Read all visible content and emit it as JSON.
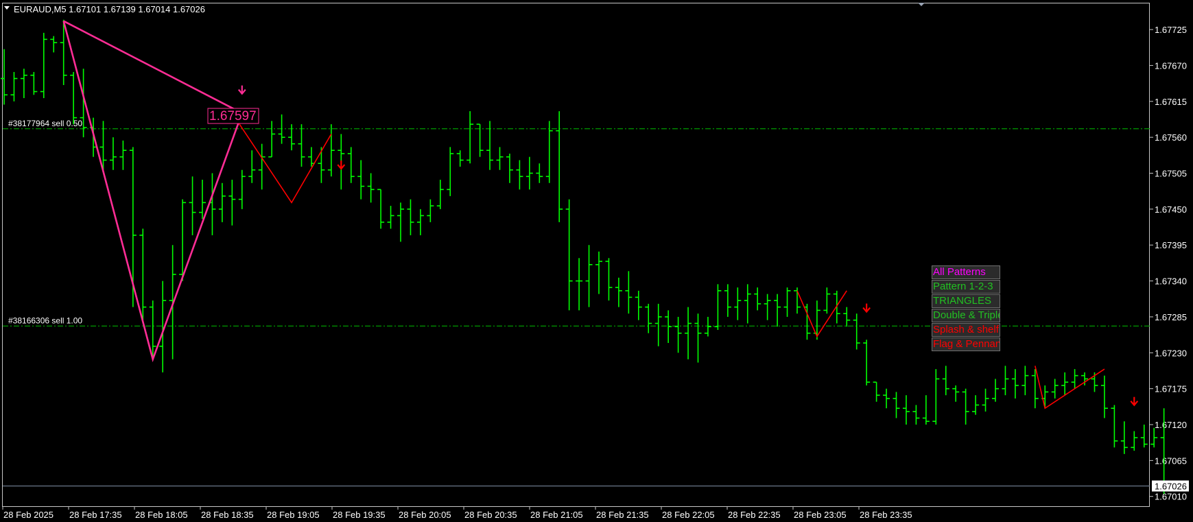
{
  "header": {
    "symbol_info": "EURAUD,M5  1.67101 1.67139 1.67014 1.67026"
  },
  "colors": {
    "background": "#000000",
    "bars": "#00ff00",
    "grid_line": "#00c000",
    "pattern_pink": "#ff2d95",
    "pattern_red": "#ff0000",
    "arrow_red": "#ff0000",
    "current_price_line": "#7f8fa6"
  },
  "orders": [
    {
      "label": "#38177964 sell 0.50",
      "price": 1.67573
    },
    {
      "label": "#38166306 sell 1.00",
      "price": 1.67271
    }
  ],
  "current_price": {
    "label": "1.67026",
    "price": 1.67026
  },
  "pattern_label": {
    "text": "1.67597"
  },
  "panel": {
    "items": [
      {
        "label": "All Patterns",
        "color": "#ff00ff"
      },
      {
        "label": "Pattern 1-2-3",
        "color": "#22c022"
      },
      {
        "label": "TRIANGLES",
        "color": "#22c022"
      },
      {
        "label": "Double & Triple",
        "color": "#22c022"
      },
      {
        "label": "Splash & shelf",
        "color": "#ff0000"
      },
      {
        "label": "Flag & Pennant",
        "color": "#ff0000"
      }
    ]
  },
  "chart_data": {
    "type": "ohlc",
    "y_axis_ticks": [
      1.67725,
      1.6767,
      1.67615,
      1.6756,
      1.67505,
      1.6745,
      1.67395,
      1.6734,
      1.67285,
      1.6723,
      1.67175,
      1.6712,
      1.67065,
      1.6701
    ],
    "x_axis_labels": [
      "28 Feb 2025",
      "28 Feb 17:35",
      "28 Feb 18:05",
      "28 Feb 18:35",
      "28 Feb 19:05",
      "28 Feb 19:35",
      "28 Feb 20:05",
      "28 Feb 20:35",
      "28 Feb 21:05",
      "28 Feb 21:35",
      "28 Feb 22:05",
      "28 Feb 22:35",
      "28 Feb 23:05",
      "28 Feb 23:35"
    ],
    "ylim": [
      1.66995,
      1.67765
    ],
    "bars": [
      [
        1.6765,
        1.67695,
        1.6761,
        1.67625
      ],
      [
        1.67625,
        1.6766,
        1.67615,
        1.6765
      ],
      [
        1.6765,
        1.67665,
        1.6762,
        1.67655
      ],
      [
        1.67655,
        1.6766,
        1.67625,
        1.6763
      ],
      [
        1.6763,
        1.6772,
        1.6762,
        1.6771
      ],
      [
        1.6771,
        1.67715,
        1.6769,
        1.67705
      ],
      [
        1.67705,
        1.6774,
        1.6764,
        1.67655
      ],
      [
        1.67655,
        1.6766,
        1.6758,
        1.6759
      ],
      [
        1.6759,
        1.67665,
        1.6756,
        1.67575
      ],
      [
        1.67575,
        1.6759,
        1.6753,
        1.67545
      ],
      [
        1.67545,
        1.67585,
        1.6751,
        1.67525
      ],
      [
        1.67525,
        1.6756,
        1.6751,
        1.6753
      ],
      [
        1.6753,
        1.67555,
        1.6751,
        1.6754
      ],
      [
        1.6754,
        1.67545,
        1.673,
        1.6741
      ],
      [
        1.6741,
        1.6742,
        1.6728,
        1.673
      ],
      [
        1.673,
        1.6731,
        1.6722,
        1.6724
      ],
      [
        1.6724,
        1.6734,
        1.672,
        1.6731
      ],
      [
        1.6731,
        1.67395,
        1.6722,
        1.6735
      ],
      [
        1.6735,
        1.67465,
        1.6734,
        1.6746
      ],
      [
        1.6746,
        1.675,
        1.6741,
        1.67445
      ],
      [
        1.67445,
        1.67495,
        1.67435,
        1.6746
      ],
      [
        1.6746,
        1.67505,
        1.6741,
        1.6745
      ],
      [
        1.6745,
        1.6749,
        1.6743,
        1.6747
      ],
      [
        1.6747,
        1.67495,
        1.67425,
        1.67465
      ],
      [
        1.67465,
        1.6751,
        1.6745,
        1.675
      ],
      [
        1.675,
        1.6754,
        1.6749,
        1.6751
      ],
      [
        1.6751,
        1.6755,
        1.6748,
        1.6753
      ],
      [
        1.6753,
        1.67585,
        1.6753,
        1.67565
      ],
      [
        1.67565,
        1.67595,
        1.6755,
        1.6756
      ],
      [
        1.6756,
        1.6758,
        1.6754,
        1.6755
      ],
      [
        1.6755,
        1.6758,
        1.67515,
        1.6753
      ],
      [
        1.6753,
        1.67545,
        1.67515,
        1.6752
      ],
      [
        1.6752,
        1.67545,
        1.6749,
        1.6751
      ],
      [
        1.6751,
        1.6758,
        1.675,
        1.6754
      ],
      [
        1.6754,
        1.67565,
        1.6748,
        1.67535
      ],
      [
        1.67535,
        1.67545,
        1.6749,
        1.675
      ],
      [
        1.675,
        1.67525,
        1.67465,
        1.67485
      ],
      [
        1.67485,
        1.67505,
        1.6746,
        1.6748
      ],
      [
        1.6748,
        1.6748,
        1.6742,
        1.6743
      ],
      [
        1.6743,
        1.67455,
        1.6742,
        1.6744
      ],
      [
        1.6744,
        1.6746,
        1.674,
        1.6745
      ],
      [
        1.6745,
        1.67465,
        1.6741,
        1.6743
      ],
      [
        1.6743,
        1.6745,
        1.6741,
        1.6744
      ],
      [
        1.6744,
        1.67465,
        1.6743,
        1.67455
      ],
      [
        1.67455,
        1.67495,
        1.6745,
        1.6748
      ],
      [
        1.6748,
        1.67545,
        1.6747,
        1.67535
      ],
      [
        1.67535,
        1.6754,
        1.67515,
        1.67525
      ],
      [
        1.67525,
        1.676,
        1.6752,
        1.6758
      ],
      [
        1.6758,
        1.6758,
        1.6753,
        1.6754
      ],
      [
        1.6754,
        1.67585,
        1.6751,
        1.67525
      ],
      [
        1.67525,
        1.67545,
        1.6751,
        1.6753
      ],
      [
        1.6753,
        1.67535,
        1.6749,
        1.6751
      ],
      [
        1.6751,
        1.67525,
        1.6748,
        1.675
      ],
      [
        1.675,
        1.6753,
        1.6748,
        1.67505
      ],
      [
        1.67505,
        1.6752,
        1.6749,
        1.675
      ],
      [
        1.675,
        1.67585,
        1.6749,
        1.6757
      ],
      [
        1.6757,
        1.676,
        1.6743,
        1.6745
      ],
      [
        1.6745,
        1.67465,
        1.67295,
        1.6734
      ],
      [
        1.6734,
        1.67375,
        1.67295,
        1.6734
      ],
      [
        1.6734,
        1.67395,
        1.673,
        1.67365
      ],
      [
        1.67365,
        1.67385,
        1.6732,
        1.6737
      ],
      [
        1.6737,
        1.67375,
        1.6731,
        1.6733
      ],
      [
        1.6733,
        1.67345,
        1.673,
        1.67325
      ],
      [
        1.67325,
        1.67355,
        1.6729,
        1.67315
      ],
      [
        1.67315,
        1.67325,
        1.6728,
        1.673
      ],
      [
        1.673,
        1.67305,
        1.6726,
        1.67275
      ],
      [
        1.67275,
        1.67305,
        1.6724,
        1.67285
      ],
      [
        1.67285,
        1.67295,
        1.67245,
        1.6727
      ],
      [
        1.6727,
        1.67285,
        1.6723,
        1.6726
      ],
      [
        1.6726,
        1.673,
        1.6722,
        1.67275
      ],
      [
        1.67275,
        1.6729,
        1.67215,
        1.6726
      ],
      [
        1.6726,
        1.67285,
        1.67255,
        1.6727
      ],
      [
        1.6727,
        1.67335,
        1.67265,
        1.67325
      ],
      [
        1.67325,
        1.67335,
        1.67285,
        1.673
      ],
      [
        1.673,
        1.6733,
        1.6728,
        1.6731
      ],
      [
        1.6731,
        1.67335,
        1.67275,
        1.6732
      ],
      [
        1.6732,
        1.6733,
        1.67295,
        1.67305
      ],
      [
        1.67305,
        1.6732,
        1.6728,
        1.6731
      ],
      [
        1.6731,
        1.6732,
        1.6727,
        1.673
      ],
      [
        1.673,
        1.6733,
        1.67285,
        1.67325
      ],
      [
        1.67325,
        1.6733,
        1.6729,
        1.673
      ],
      [
        1.673,
        1.67305,
        1.6725,
        1.6726
      ],
      [
        1.6726,
        1.6731,
        1.6725,
        1.67295
      ],
      [
        1.67295,
        1.6733,
        1.6729,
        1.6732
      ],
      [
        1.6732,
        1.67325,
        1.67275,
        1.6729
      ],
      [
        1.6729,
        1.673,
        1.6727,
        1.6728
      ],
      [
        1.6728,
        1.6729,
        1.67235,
        1.67245
      ],
      [
        1.67245,
        1.6725,
        1.6718,
        1.67185
      ],
      [
        1.67185,
        1.67185,
        1.67155,
        1.67165
      ],
      [
        1.67165,
        1.67175,
        1.67145,
        1.6716
      ],
      [
        1.6716,
        1.6717,
        1.6713,
        1.67145
      ],
      [
        1.67145,
        1.67165,
        1.6712,
        1.6714
      ],
      [
        1.6714,
        1.6715,
        1.6712,
        1.6713
      ],
      [
        1.6713,
        1.67165,
        1.6712,
        1.67125
      ],
      [
        1.67125,
        1.67205,
        1.6712,
        1.6719
      ],
      [
        1.6719,
        1.6721,
        1.67165,
        1.67175
      ],
      [
        1.67175,
        1.6718,
        1.67155,
        1.6717
      ],
      [
        1.6717,
        1.67175,
        1.6712,
        1.6714
      ],
      [
        1.6714,
        1.67165,
        1.67135,
        1.6715
      ],
      [
        1.6715,
        1.67175,
        1.6714,
        1.6716
      ],
      [
        1.6716,
        1.6719,
        1.67155,
        1.67175
      ],
      [
        1.67175,
        1.6721,
        1.67165,
        1.6719
      ],
      [
        1.6719,
        1.67205,
        1.6716,
        1.6718
      ],
      [
        1.6718,
        1.6721,
        1.67165,
        1.67195
      ],
      [
        1.67195,
        1.67205,
        1.67145,
        1.6716
      ],
      [
        1.6716,
        1.6718,
        1.67145,
        1.6717
      ],
      [
        1.6717,
        1.6719,
        1.6716,
        1.6718
      ],
      [
        1.6718,
        1.672,
        1.67165,
        1.67185
      ],
      [
        1.67185,
        1.67205,
        1.67175,
        1.67195
      ],
      [
        1.67195,
        1.672,
        1.6718,
        1.6719
      ],
      [
        1.6719,
        1.672,
        1.6717,
        1.6718
      ],
      [
        1.6718,
        1.67195,
        1.6713,
        1.67145
      ],
      [
        1.67145,
        1.6715,
        1.67085,
        1.67095
      ],
      [
        1.67095,
        1.67125,
        1.67075,
        1.67085
      ],
      [
        1.67085,
        1.6711,
        1.6708,
        1.671
      ],
      [
        1.671,
        1.6712,
        1.67085,
        1.6709
      ],
      [
        1.6709,
        1.67115,
        1.67085,
        1.671
      ],
      [
        1.671,
        1.67145,
        1.67014,
        1.67026
      ]
    ],
    "pattern_lines": [
      {
        "color": "#ff2d95",
        "points": [
          [
            6,
            1.67738
          ],
          [
            15,
            1.6722
          ],
          [
            24,
            1.67597
          ],
          [
            6,
            1.67738
          ]
        ]
      },
      {
        "color": "#ff0000",
        "points": [
          [
            23,
            1.67597
          ],
          [
            29,
            1.6746
          ],
          [
            33,
            1.67565
          ]
        ]
      },
      {
        "color": "#ff0000",
        "points": [
          [
            80,
            1.67325
          ],
          [
            82,
            1.67255
          ],
          [
            85,
            1.67325
          ]
        ]
      },
      {
        "color": "#ff0000",
        "points": [
          [
            104,
            1.6721
          ],
          [
            105,
            1.67145
          ],
          [
            111,
            1.67205
          ]
        ]
      }
    ],
    "arrows": [
      {
        "index": 24,
        "price": 1.67632,
        "color": "#ff2d95"
      },
      {
        "index": 34,
        "price": 1.67517,
        "color": "#ff0000"
      },
      {
        "index": 87,
        "price": 1.67298,
        "color": "#ff0000"
      },
      {
        "index": 114,
        "price": 1.67155,
        "color": "#ff0000"
      }
    ]
  }
}
